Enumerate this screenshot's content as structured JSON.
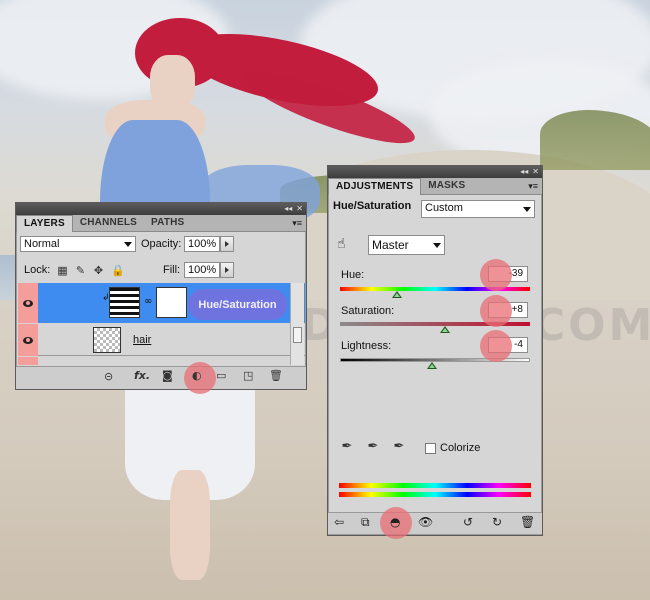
{
  "layers_panel": {
    "tabs": [
      "LAYERS",
      "CHANNELS",
      "PATHS"
    ],
    "blend_mode": "Normal",
    "opacity_label": "Opacity:",
    "opacity_value": "100%",
    "lock_label": "Lock:",
    "fill_label": "Fill:",
    "fill_value": "100%",
    "layers": [
      {
        "name": "",
        "type": "hue-saturation adjustment",
        "selected": true
      },
      {
        "name": "hair",
        "type": "image",
        "selected": false
      }
    ],
    "bottom_icons": [
      "link-layers-icon",
      "fx-icon",
      "add-mask-icon",
      "new-adjustment-layer-icon",
      "new-group-icon",
      "new-layer-icon",
      "trash-icon"
    ]
  },
  "annotation": {
    "hue_saturation_label": "Hue/Saturation"
  },
  "adjustments_panel": {
    "tabs": [
      "ADJUSTMENTS",
      "MASKS"
    ],
    "title": "Hue/Saturation",
    "preset": "Custom",
    "channel": "Master",
    "hue_label": "Hue:",
    "hue_value": "-39",
    "saturation_label": "Saturation:",
    "saturation_value": "+8",
    "lightness_label": "Lightness:",
    "lightness_value": "-4",
    "colorize_label": "Colorize",
    "colorize_checked": false,
    "slider_levels": {
      "hue": -39,
      "saturation": 8,
      "lightness": -4
    }
  },
  "watermark": "WWW.PSD-DUDE.COM",
  "colors": {
    "accent_selected": "#3e8cf0",
    "highlight": "#e86e76"
  }
}
